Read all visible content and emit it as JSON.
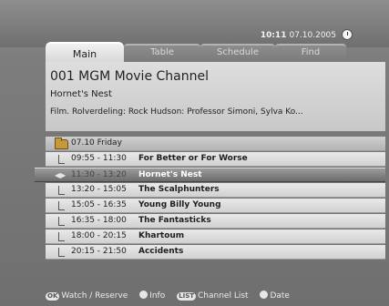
{
  "header": {
    "time": "10:11",
    "date": "07.10.2005",
    "clock_icon": "clock-icon"
  },
  "tabs": [
    {
      "label": "Main",
      "active": true
    },
    {
      "label": "Table",
      "active": false
    },
    {
      "label": "Schedule",
      "active": false
    },
    {
      "label": "Find",
      "active": false
    }
  ],
  "info": {
    "channel": "001 MGM Movie Channel",
    "title": "Hornet's Nest",
    "description": "Film.  Rolverdeling: Rock Hudson: Professor Simoni, Sylva Ko..."
  },
  "list": {
    "date_row": {
      "icon": "folder-icon",
      "label": "07.10 Friday"
    },
    "programs": [
      {
        "time": "09:55 - 11:30",
        "title": "For Better or For Worse",
        "selected": false
      },
      {
        "time": "11:30 - 13:20",
        "title": "Hornet's Nest",
        "selected": true
      },
      {
        "time": "13:20 - 15:05",
        "title": "The Scalphunters",
        "selected": false
      },
      {
        "time": "15:05 - 16:35",
        "title": "Young Billy Young",
        "selected": false
      },
      {
        "time": "16:35 - 18:00",
        "title": "The Fantasticks",
        "selected": false
      },
      {
        "time": "18:00 - 20:15",
        "title": "Khartoum",
        "selected": false
      },
      {
        "time": "20:15 - 21:50",
        "title": "Accidents",
        "selected": false
      }
    ]
  },
  "footer": {
    "ok_key": "OK",
    "ok_label": "Watch / Reserve",
    "info_label": "Info",
    "list_key": "LIST",
    "list_label": "Channel List",
    "date_label": "Date"
  },
  "colors": {
    "background": "#7d7d7d",
    "selected_row": "#6d6d6d",
    "row": "#e9e9e9"
  }
}
